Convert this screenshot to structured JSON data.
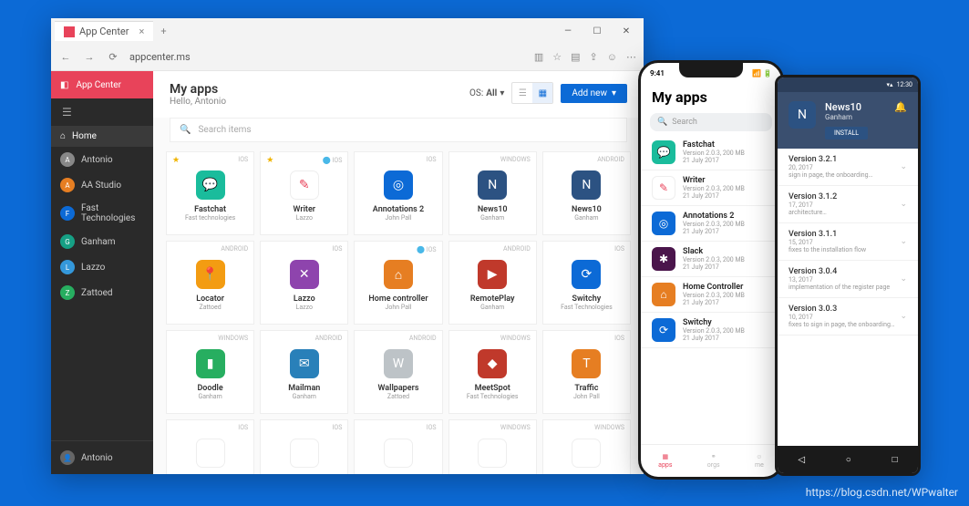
{
  "browser": {
    "tab_title": "App Center",
    "url": "appcenter.ms"
  },
  "sidebar": {
    "brand": "App Center",
    "home": "Home",
    "items": [
      {
        "label": "Antonio",
        "color": "#888"
      },
      {
        "label": "AA Studio",
        "color": "#e67e22"
      },
      {
        "label": "Fast Technologies",
        "color": "#0c6ad6"
      },
      {
        "label": "Ganham",
        "color": "#16a085"
      },
      {
        "label": "Lazzo",
        "color": "#3498db"
      },
      {
        "label": "Zattoed",
        "color": "#27ae60"
      }
    ],
    "footer_user": "Antonio"
  },
  "header": {
    "title": "My apps",
    "greeting": "Hello, Antonio",
    "os_label": "OS:",
    "os_value": "All",
    "add_new": "Add new"
  },
  "search_placeholder": "Search items",
  "apps": [
    {
      "name": "Fastchat",
      "owner": "Fast technologies",
      "os": "IOS",
      "color": "#1abc9c",
      "star": true,
      "glyph": "💬"
    },
    {
      "name": "Writer",
      "owner": "Lazzo",
      "os": "IOS",
      "color": "#fff",
      "star": true,
      "hockey": true,
      "glyph": "✎",
      "fg": "#e8435a"
    },
    {
      "name": "Annotations 2",
      "owner": "John Pall",
      "os": "IOS",
      "color": "#0c6ad6",
      "glyph": "◎"
    },
    {
      "name": "News10",
      "owner": "Ganham",
      "os": "WINDOWS",
      "color": "#2c5282",
      "glyph": "N"
    },
    {
      "name": "News10",
      "owner": "Ganham",
      "os": "ANDROID",
      "color": "#2c5282",
      "glyph": "N"
    },
    {
      "name": "Locator",
      "owner": "Zattoed",
      "os": "ANDROID",
      "color": "#f39c12",
      "glyph": "📍"
    },
    {
      "name": "Lazzo",
      "owner": "Lazzo",
      "os": "IOS",
      "color": "#8e44ad",
      "glyph": "✕"
    },
    {
      "name": "Home controller",
      "owner": "John Pall",
      "os": "IOS",
      "color": "#e67e22",
      "hockey": true,
      "glyph": "⌂"
    },
    {
      "name": "RemotePlay",
      "owner": "Ganham",
      "os": "ANDROID",
      "color": "#c0392b",
      "glyph": "▶"
    },
    {
      "name": "Switchy",
      "owner": "Fast Technologies",
      "os": "IOS",
      "color": "#0c6ad6",
      "glyph": "⟳"
    },
    {
      "name": "Doodle",
      "owner": "Ganham",
      "os": "WINDOWS",
      "color": "#27ae60",
      "glyph": "▮"
    },
    {
      "name": "Mailman",
      "owner": "Ganham",
      "os": "ANDROID",
      "color": "#2980b9",
      "glyph": "✉"
    },
    {
      "name": "Wallpapers",
      "owner": "Zattoed",
      "os": "ANDROID",
      "color": "#bdc3c7",
      "glyph": "W"
    },
    {
      "name": "MeetSpot",
      "owner": "Fast Technologies",
      "os": "WINDOWS",
      "color": "#c0392b",
      "glyph": "◆"
    },
    {
      "name": "Traffic",
      "owner": "John Pall",
      "os": "IOS",
      "color": "#e67e22",
      "glyph": "T"
    },
    {
      "name": "",
      "owner": "",
      "os": "IOS",
      "color": "#fff",
      "glyph": ""
    },
    {
      "name": "",
      "owner": "",
      "os": "IOS",
      "color": "#fff",
      "glyph": ""
    },
    {
      "name": "",
      "owner": "",
      "os": "IOS",
      "color": "#fff",
      "glyph": ""
    },
    {
      "name": "",
      "owner": "",
      "os": "WINDOWS",
      "color": "#fff",
      "glyph": ""
    },
    {
      "name": "",
      "owner": "",
      "os": "WINDOWS",
      "color": "#fff",
      "glyph": ""
    }
  ],
  "ios": {
    "time": "9:41",
    "title": "My apps",
    "search": "Search",
    "meta": "Version 2.0.3, 200 MB",
    "date": "21 July 2017",
    "items": [
      {
        "name": "Fastchat",
        "color": "#1abc9c",
        "glyph": "💬"
      },
      {
        "name": "Writer",
        "color": "#fff",
        "glyph": "✎",
        "fg": "#e8435a"
      },
      {
        "name": "Annotations 2",
        "color": "#0c6ad6",
        "glyph": "◎"
      },
      {
        "name": "Slack",
        "color": "#4a154b",
        "glyph": "✱"
      },
      {
        "name": "Home Controller",
        "color": "#e67e22",
        "glyph": "⌂"
      },
      {
        "name": "Switchy",
        "color": "#0c6ad6",
        "glyph": "⟳"
      }
    ],
    "tabs": [
      "apps",
      "orgs",
      "me"
    ]
  },
  "android": {
    "time": "12:30",
    "title": "News10",
    "owner": "Ganham",
    "install": "INSTALL",
    "items": [
      {
        "name": "Version 3.2.1",
        "meta": "sign in page, the onboarding…",
        "date": "20, 2017"
      },
      {
        "name": "Version 3.1.2",
        "meta": "architecture…",
        "date": "17, 2017"
      },
      {
        "name": "Version 3.1.1",
        "meta": "fixes to the installation flow",
        "date": "15, 2017"
      },
      {
        "name": "Version 3.0.4",
        "meta": "implementation of the register page",
        "date": "13, 2017"
      },
      {
        "name": "Version 3.0.3",
        "meta": "fixes to sign in page, the onboarding…",
        "date": "10, 2017"
      }
    ]
  },
  "watermark": "https://blog.csdn.net/WPwalter"
}
